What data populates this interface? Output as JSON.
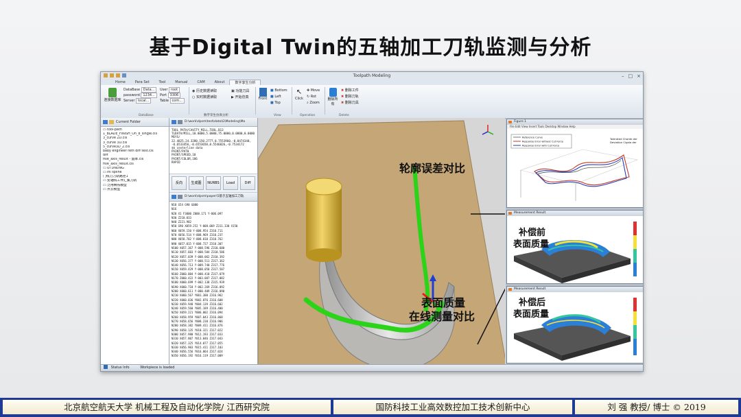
{
  "slide_title": "基于Digital Twin的五轴加工刀轨监测与分析",
  "window": {
    "title": "Toolpath Modeling",
    "controls": [
      "–",
      "□",
      "×"
    ]
  },
  "ribbon": {
    "tabs": [
      "Home",
      "Para Set",
      "Tool",
      "Manual",
      "CAM",
      "About",
      "数字孪生分析"
    ],
    "active_tab": "数字孪生分析",
    "connect_button": "连接数据库",
    "db_fields": [
      {
        "label": "DataBase",
        "value": "Data..."
      },
      {
        "label": "password",
        "value": "1234..."
      },
      {
        "label": "Server",
        "value": "local..."
      }
    ],
    "user_fields": [
      {
        "label": "User",
        "value": "root"
      },
      {
        "label": "Port",
        "value": "3306"
      },
      {
        "label": "Table",
        "value": "com..."
      }
    ],
    "group_database": "DataBase",
    "options": [
      "历史数据读取",
      "实时数据读取"
    ],
    "gen_buttons": [
      "功能刀具",
      "开始仿真"
    ],
    "group_digital": "数字孪生仿真分析",
    "front_button": "Front",
    "view_buttons": [
      "Bottom",
      "Left",
      "Top"
    ],
    "group_view": "View",
    "click_button": "Click",
    "zoom_buttons": [
      "Move",
      "Rot",
      "Zoom"
    ],
    "group_operation": "Operation",
    "delete_button": "删除所有",
    "delete_items": [
      "删除工件",
      "删除刀轨",
      "删除刀具"
    ],
    "group_delete": "Delete"
  },
  "folder_panel": {
    "header": "Current Folder",
    "items": [
      "▭ tool-path",
      "   1_BLADE_FINISH_On_8_single.cls",
      "   3_curve 2D.cls",
      "   3_curve 3D.cls",
      "   5_curve3D_2.cls",
      "   baby engineer rem diff test.cls",
      "   diff",
      "   five_axis_result - 副本.cls",
      "   five_axis_result.cls",
      "▭ UI DNDNG",
      "▭ ini spline",
      "   门铣刀刀轨路径1",
      "▭ 变轴铣工件汇集刀轨",
      "▭ 泛用精铣模型",
      "▭ 点云模型"
    ]
  },
  "code_panel_top": {
    "path": "D:\\work\\dpsm\\test\\data\\G\\Modeling\\Mo",
    "lines": [
      "TOOL PATH/CAVITY_MILL,TOOL,B13",
      "TLDATA/MILL,10.0000,5.0000,75.0000,0.0000,0.0000",
      "MSYS/",
      "22.4825,24.3280,150.2777,0.7553960,-0.0474340,",
      "-0.6533456,-0.6553650,0.5546826,-0.7534172",
      "$$ centerline data",
      "PAINT/PATH",
      "PAINT/SPEED,10",
      "PAINT/COLOR,186",
      "RAPID"
    ]
  },
  "action_buttons": [
    "反向",
    "生成图",
    "NURBS",
    "Load",
    "Diff"
  ],
  "code_panel_bottom": {
    "path": "D:\\work\\dpsm\\paper\\5基于五轴加工刀轨",
    "lines": [
      "N10 G54 G90 G000",
      "N16",
      "N20 X1 F3000 Z000.171 Y-006.097",
      "N30 Z210.033",
      "N40 Z221.902",
      "N50 G90 X059.252 Y-008.069 Z311.330 X150",
      "N60 X059.150 Y-008.954 Z310.711",
      "N70 X056.514 Y-008.969 Z310.237",
      "N80 X058.702 Y-008.010 Z310.762",
      "N90 X057.015 Y-008.727 Z310.307",
      "N100 X057.367 Y-008.596 Z310.600",
      "N110 X057.603 Y-008.504 Z310.506",
      "N120 X057.039 Y-008.062 Z310.392",
      "N130 X056.377 Y-008.511 Z317.362",
      "N140 X056.713 Y-009.740 Z317.776",
      "N150 X059.429 Y-008.050 Z317.507",
      "N160 Z060.004 Y-008.410 Z317.079",
      "N170 Z060.422 Y-003.087 Z317.082",
      "N180 X060.699 Y-002.138 Z315.939",
      "N190 X060.718 Y-002.269 Z316.092",
      "N200 X060.611 Y-000.409 Z316.090",
      "N210 X060.567 Y001.380 Z316.962",
      "N220 X060.036 Y002.876 Z316.608",
      "N230 X059.948 Y004.139 Z316.602",
      "N240 X059.560 Y005.189 Z316.400",
      "N250 X059.221 Y006.002 Z316.094",
      "N260 X058.959 Y007.043 Z316.868",
      "N270 X058.656 Y008.238 Z316.906",
      "N280 X058.382 Y009.411 Z316.876",
      "N290 X058.135 Y010.321 Z317.022",
      "N300 X057.980 Y012.193 Z317.033",
      "N310 X057.807 Y013.046 Z317.043",
      "N320 X057.325 Y014.077 Z317.055",
      "N330 X056.903 Y015.411 Z317.103",
      "N340 X056.556 Y016.064 Z317.024",
      "N350 X056.192 Y016.119 Z317.009"
    ]
  },
  "annotations": {
    "contour": "轮廓误差对比",
    "quality_line1": "表面质量",
    "quality_line2": "在线测量对比",
    "before_line1": "补偿前",
    "before_line2": "表面质量",
    "after_line1": "补偿后",
    "after_line2": "表面质量"
  },
  "figure1": {
    "window_title": "Figure 1",
    "menu": [
      "File",
      "Edit",
      "View",
      "Insert",
      "Tools",
      "Desktop",
      "Window",
      "Help"
    ],
    "legend": [
      "Reference Curve",
      "Response Error without Cut Force",
      "Response Error with Cut Force"
    ],
    "side_label": [
      "Tolerated Chorde der",
      "Deviation Cigalo der"
    ]
  },
  "figure2": {
    "window_title": "Measurement Result"
  },
  "figure3": {
    "window_title": "Measurement Result"
  },
  "status": {
    "label": "Status Info",
    "text": "Workpiece is loaded"
  },
  "footer": {
    "left": "北京航空航天大学 机械工程及自动化学院/ 江西研究院",
    "center": "国防科技工业高效数控加工技术创新中心",
    "right": "刘 强 教授/ 博士 © 2019"
  },
  "colors": {
    "footer_bar": "#1f3a93",
    "footer_cell": "#f6f0d9",
    "toolpath": "#2bd418"
  }
}
